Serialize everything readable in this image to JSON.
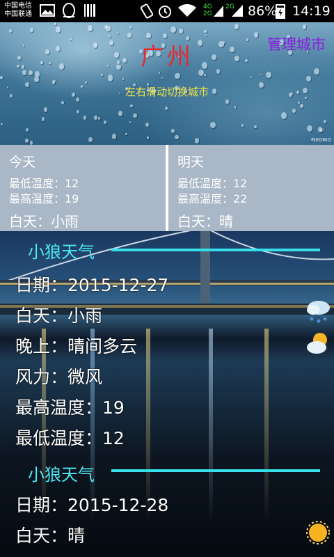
{
  "status_bar": {
    "carrier_1": "中国电信",
    "carrier_2": "中国联通",
    "battery": "86%",
    "time": "14:19",
    "network_1": "4G",
    "network_2": "2G",
    "network_3": "2G"
  },
  "header": {
    "city": "广州",
    "manage_label": "管理城市",
    "hint": "左右滑动切换城市",
    "watermark": "NEOBIO"
  },
  "today": {
    "title": "今天",
    "low": "最低温度：12",
    "high": "最高温度：19",
    "day": "白天：小雨"
  },
  "tomorrow": {
    "title": "明天",
    "low": "最低温度：12",
    "high": "最高温度：22",
    "day": "白天：晴"
  },
  "entries": [
    {
      "title": "小狼天气",
      "date": "日期：2015-12-27",
      "day": "白天：小雨",
      "night": "晚上：晴间多云",
      "wind": "风力：微风",
      "high": "最高温度：19",
      "low": "最低温度：12",
      "day_icon": "rain-cloud-icon",
      "night_icon": "partly-cloudy-icon"
    },
    {
      "title": "小狼天气",
      "date": "日期：2015-12-28",
      "day": "白天：晴",
      "day_icon": "sun-icon"
    }
  ]
}
